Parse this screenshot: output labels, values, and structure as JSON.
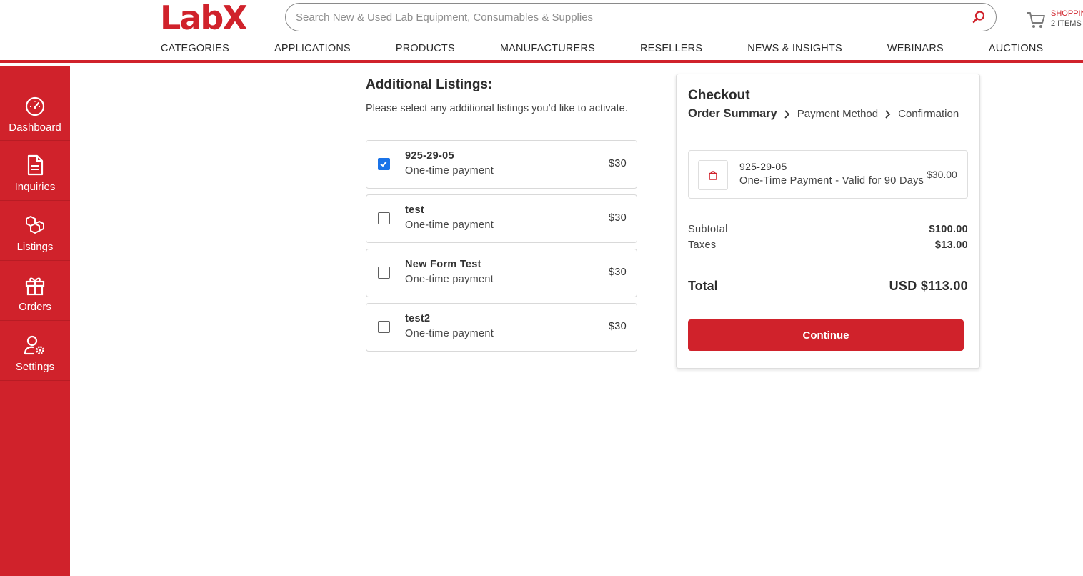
{
  "header": {
    "logo": "LabX",
    "search_placeholder": "Search New & Used Lab Equipment, Consumables & Supplies",
    "cart_title": "SHOPPING CART",
    "cart_count": "2 ITEMS -",
    "nav": [
      "CATEGORIES",
      "APPLICATIONS",
      "PRODUCTS",
      "MANUFACTURERS",
      "RESELLERS",
      "NEWS & INSIGHTS",
      "WEBINARS",
      "AUCTIONS"
    ]
  },
  "sidebar": {
    "items": [
      {
        "label": "Dashboard",
        "icon": "gauge-icon"
      },
      {
        "label": "Inquiries",
        "icon": "document-icon"
      },
      {
        "label": "Listings",
        "icon": "boxes-icon"
      },
      {
        "label": "Orders",
        "icon": "gift-icon"
      },
      {
        "label": "Settings",
        "icon": "user-gear-icon"
      }
    ]
  },
  "listings": {
    "title": "Additional Listings:",
    "subtitle": "Please select any additional listings you’d like to activate.",
    "items": [
      {
        "name": "925-29-05",
        "desc": "One-time payment",
        "price": "$30",
        "checked": true
      },
      {
        "name": "test",
        "desc": "One-time payment",
        "price": "$30",
        "checked": false
      },
      {
        "name": "New Form Test",
        "desc": "One-time payment",
        "price": "$30",
        "checked": false
      },
      {
        "name": "test2",
        "desc": "One-time payment",
        "price": "$30",
        "checked": false
      }
    ]
  },
  "checkout": {
    "title": "Checkout",
    "steps": [
      "Order Summary",
      "Payment Method",
      "Confirmation"
    ],
    "item": {
      "name": "925-29-05",
      "desc": "One-Time Payment - Valid for 90 Days",
      "price": "$30.00"
    },
    "subtotal_label": "Subtotal",
    "subtotal": "$100.00",
    "taxes_label": "Taxes",
    "taxes": "$13.00",
    "total_label": "Total",
    "total": "USD $113.00",
    "continue_label": "Continue"
  },
  "colors": {
    "brand": "#d0222b",
    "checkbox": "#1a73e8"
  }
}
